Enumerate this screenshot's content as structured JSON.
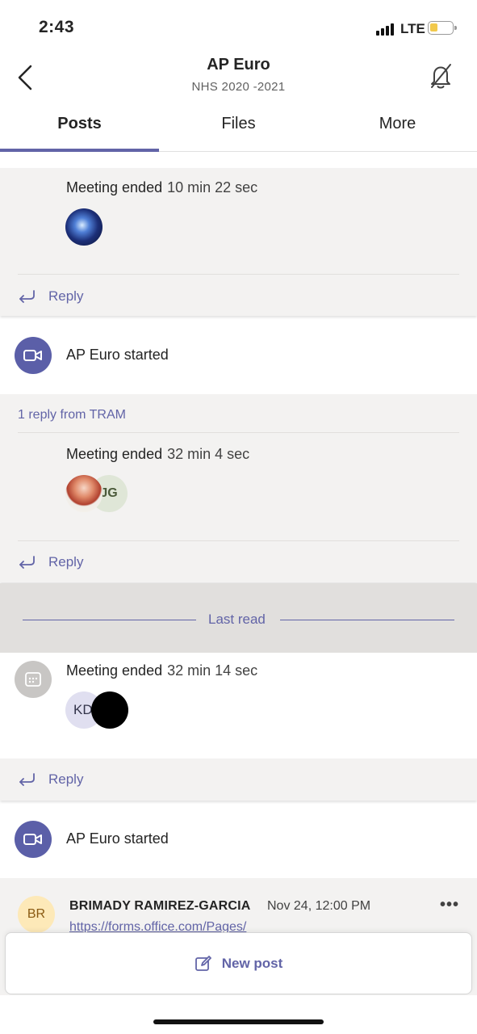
{
  "status_bar": {
    "time": "2:43",
    "network": "LTE"
  },
  "header": {
    "title": "AP Euro",
    "subtitle": "NHS 2020 -2021",
    "back_icon": "chevron-left-icon",
    "bell_icon": "bell-off-icon"
  },
  "tabs": [
    {
      "label": "Posts",
      "active": true
    },
    {
      "label": "Files",
      "active": false
    },
    {
      "label": "More",
      "active": false
    }
  ],
  "feed": {
    "thread1": {
      "meeting_label": "Meeting ended",
      "duration": "10 min 22 sec",
      "reply_label": "Reply"
    },
    "thread2": {
      "started": "AP Euro started",
      "reply_count": "1 reply from TRAM",
      "meeting_label": "Meeting ended",
      "duration": "32 min 4 sec",
      "avatar_initials": "JG",
      "reply_label": "Reply"
    },
    "last_read": "Last read",
    "thread3": {
      "meeting_label": "Meeting ended",
      "duration": "32 min 14 sec",
      "avatar_initials": "KD",
      "reply_label": "Reply"
    },
    "thread4": {
      "started": "AP Euro started"
    },
    "post": {
      "author_initials": "BR",
      "author": "BRIMADY RAMIREZ-GARCIA",
      "time": "Nov 24, 12:00 PM",
      "more": "•••",
      "link": "https://forms.office.com/Pages/"
    }
  },
  "new_post": {
    "label": "New post"
  },
  "colors": {
    "accent": "#6264a7",
    "video_circle": "#5b5fa8",
    "feed_gray": "#f3f2f1",
    "last_read_band": "#e1dfdd"
  }
}
